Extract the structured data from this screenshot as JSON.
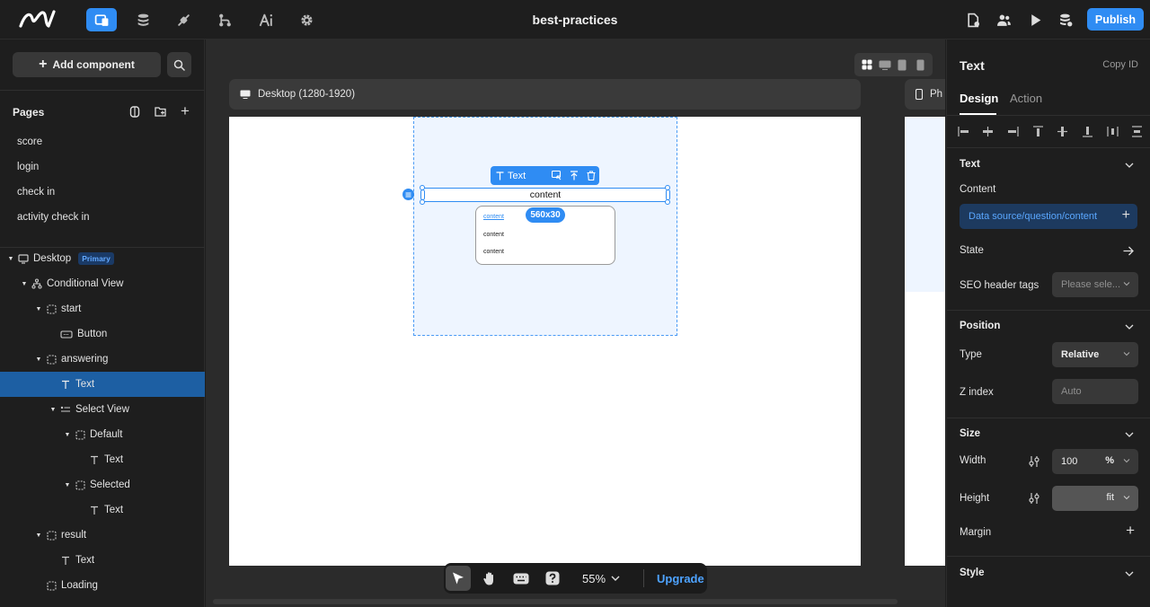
{
  "app": {
    "title": "best-practices",
    "publish_label": "Publish",
    "accent": "#2f8cf3"
  },
  "toolbar_icons": [
    "pages-icon",
    "database-icon",
    "plugins-icon",
    "workflow-icon",
    "ai-icon",
    "settings-icon"
  ],
  "left": {
    "add_component_label": "Add component",
    "pages_title": "Pages",
    "pages": [
      "score",
      "login",
      "check in",
      "activity check in"
    ],
    "tree": {
      "desktop": "Desktop",
      "primary_badge": "Primary",
      "conditional_view": "Conditional View",
      "start": "start",
      "button": "Button",
      "answering": "answering",
      "text": "Text",
      "select_view": "Select View",
      "default": "Default",
      "selected": "Selected",
      "result": "result",
      "loading": "Loading"
    }
  },
  "canvas": {
    "frame_label": "Desktop (1280-1920)",
    "frame2_label": "Ph",
    "selected_element_label": "Text",
    "text_content": "content",
    "size_badge": "560x30",
    "options": [
      "content",
      "content",
      "content"
    ],
    "zoom": "55%",
    "upgrade_label": "Upgrade"
  },
  "right": {
    "title": "Text",
    "copy_id": "Copy ID",
    "tabs": [
      "Design",
      "Action"
    ],
    "text_section": "Text",
    "content_label": "Content",
    "data_source": "Data source/question/content",
    "state_label": "State",
    "seo_label": "SEO header tags",
    "seo_placeholder": "Please sele...",
    "position_section": "Position",
    "type_label": "Type",
    "type_value": "Relative",
    "zindex_label": "Z index",
    "zindex_placeholder": "Auto",
    "size_section": "Size",
    "width_label": "Width",
    "width_value": "100",
    "width_unit": "%",
    "height_label": "Height",
    "height_value": "fit",
    "margin_label": "Margin",
    "style_section": "Style"
  }
}
